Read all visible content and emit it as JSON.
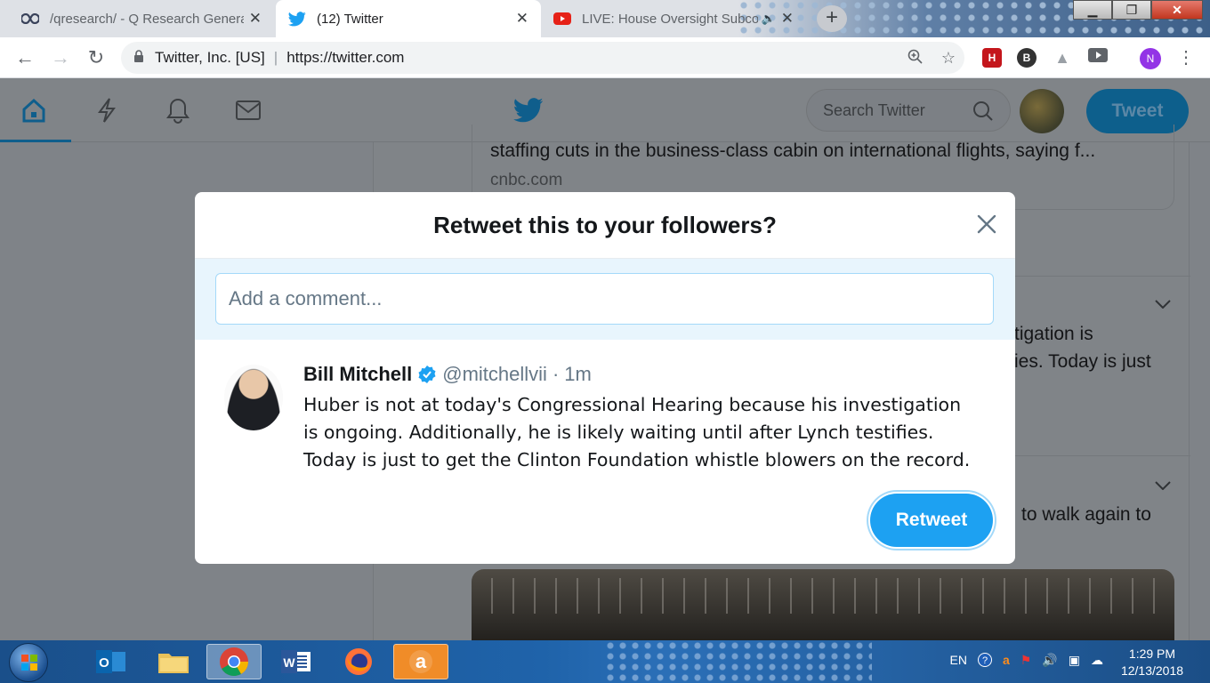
{
  "browser": {
    "tabs": [
      {
        "title": "/qresearch/ - Q Research Genera",
        "icon": "infinity-icon"
      },
      {
        "title": "(12) Twitter",
        "icon": "twitter-bird-icon"
      },
      {
        "title": "LIVE: House Oversight Subco",
        "icon": "youtube-icon"
      }
    ],
    "site_identity": "Twitter, Inc. [US]",
    "url": "https://twitter.com",
    "profile_initial": "N",
    "window": {
      "minimize": "▁",
      "restore": "❐",
      "close": "✕"
    }
  },
  "twitter": {
    "search_placeholder": "Search Twitter",
    "tweet_button": "Tweet",
    "bg_card_text": "staffing cuts in the business-class cabin on international flights, saying f...",
    "bg_card_domain": "cnbc.com",
    "bg_text_1": "tigation is",
    "bg_text_2": "ies.  Today is just",
    "bg_text_3": "to walk again to"
  },
  "modal": {
    "title": "Retweet this to your followers?",
    "comment_placeholder": "Add a comment...",
    "tweet": {
      "name": "Bill Mitchell",
      "handle": "@mitchellvii",
      "separator": "·",
      "time": "1m",
      "text": "Huber is not at today's Congressional Hearing because his investigation is ongoing.  Additionally, he is likely waiting until after Lynch testifies.  Today is just to get the Clinton Foundation whistle blowers on the record."
    },
    "retweet_button": "Retweet"
  },
  "taskbar": {
    "language": "EN",
    "time": "1:29 PM",
    "date": "12/13/2018"
  },
  "colors": {
    "twitter_blue": "#1da1f2",
    "overlay_bg": "#7f8388",
    "comment_bg": "#e8f5fd"
  }
}
